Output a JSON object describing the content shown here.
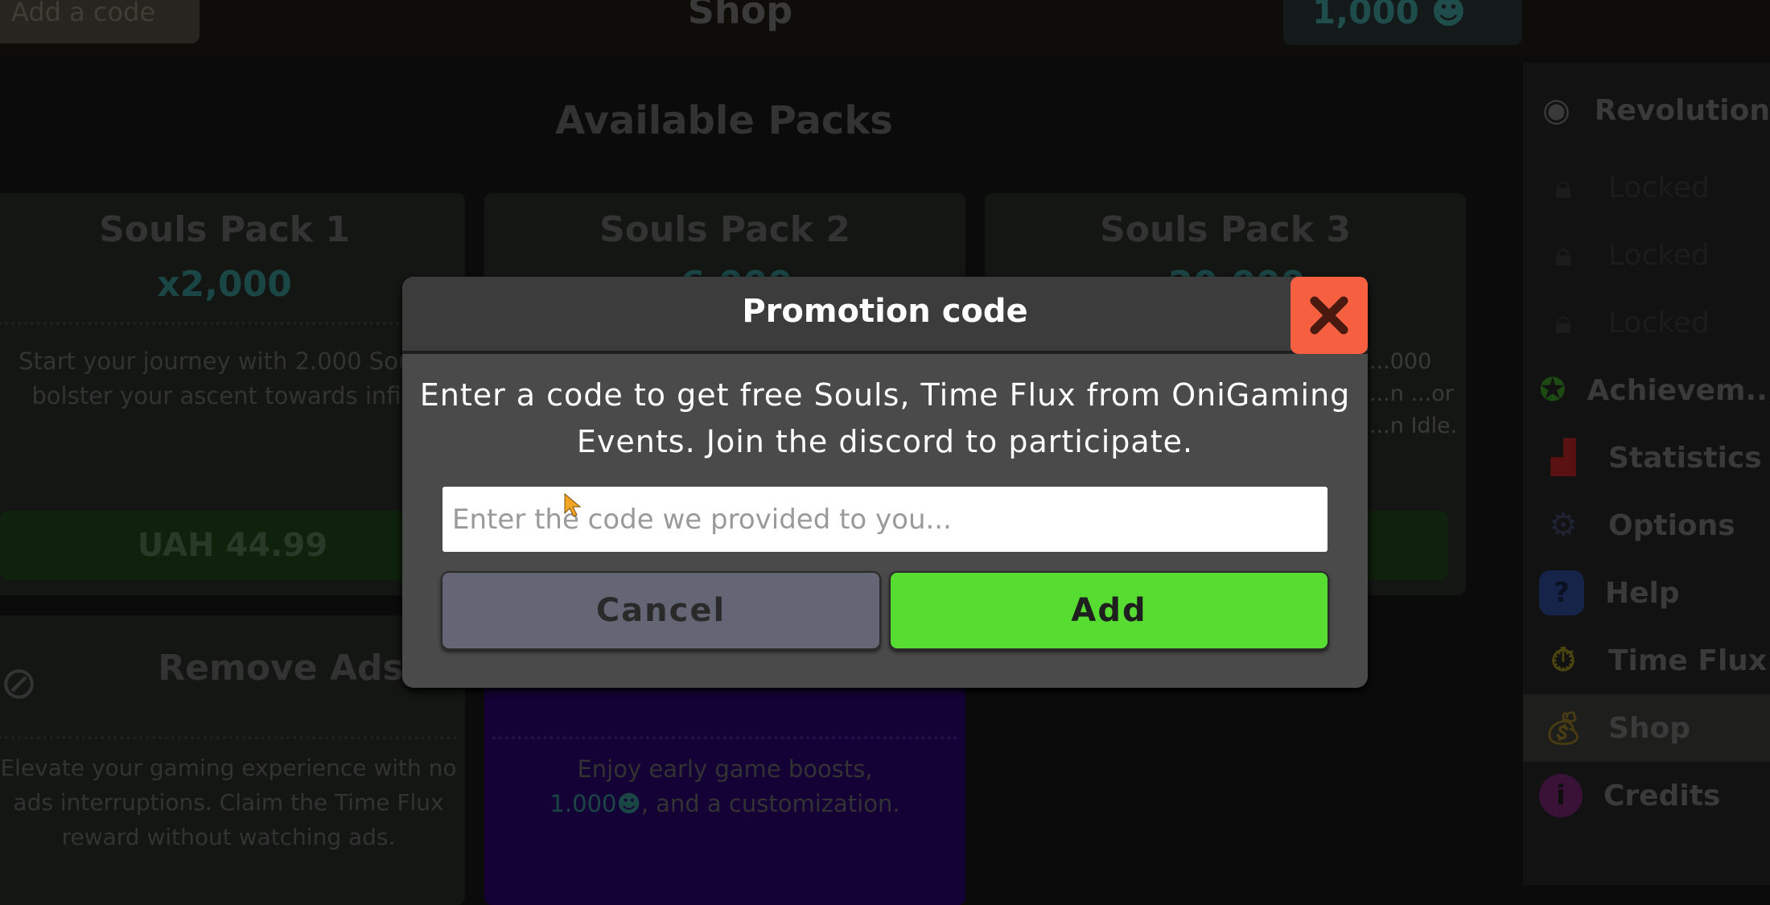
{
  "topbar": {
    "add_code_label": "Add a code",
    "title": "Shop",
    "currency_value": "1,000"
  },
  "main": {
    "section_title": "Available Packs",
    "packs": [
      {
        "title": "Souls Pack 1",
        "amount": "x2,000",
        "description": "Start your journey with 2.000 Souls to bolster your ascent towards infinity.",
        "price": "UAH 44.99"
      },
      {
        "title": "Souls Pack 2",
        "amount": "x6,000"
      },
      {
        "title": "Souls Pack 3",
        "amount": "x20,000",
        "description_fragment": "...000 ...n ...or ...n Idle."
      }
    ],
    "remove_ads": {
      "title": "Remove Ads",
      "description": "Elevate your gaming experience with no ads interruptions. Claim the Time Flux reward without watching ads."
    },
    "starter": {
      "description_1": "Enjoy early game boosts,",
      "amount": "1.000",
      "description_2": ", and a customization."
    }
  },
  "sidebar": {
    "items": [
      {
        "label": "Revolution",
        "icon": "target-icon"
      },
      {
        "label": "Locked",
        "icon": "lock-icon"
      },
      {
        "label": "Locked",
        "icon": "lock-icon"
      },
      {
        "label": "Locked",
        "icon": "lock-icon"
      },
      {
        "label": "Achievem...",
        "icon": "medal-icon"
      },
      {
        "label": "Statistics",
        "icon": "bar-chart-icon"
      },
      {
        "label": "Options",
        "icon": "gear-icon"
      },
      {
        "label": "Help",
        "icon": "help-icon"
      },
      {
        "label": "Time Flux",
        "icon": "stopwatch-icon"
      },
      {
        "label": "Shop",
        "icon": "money-bag-icon",
        "active": true
      },
      {
        "label": "Credits",
        "icon": "info-icon"
      }
    ]
  },
  "modal": {
    "title": "Promotion code",
    "message": "Enter a code to get free Souls, Time Flux from OniGaming Events. Join the discord to participate.",
    "input_placeholder": "Enter the code we provided to you...",
    "input_value": "",
    "cancel_label": "Cancel",
    "add_label": "Add"
  },
  "colors": {
    "close": "#f75f41",
    "add": "#57dd31",
    "cancel": "#646676",
    "modal": "#4a4a4a"
  }
}
